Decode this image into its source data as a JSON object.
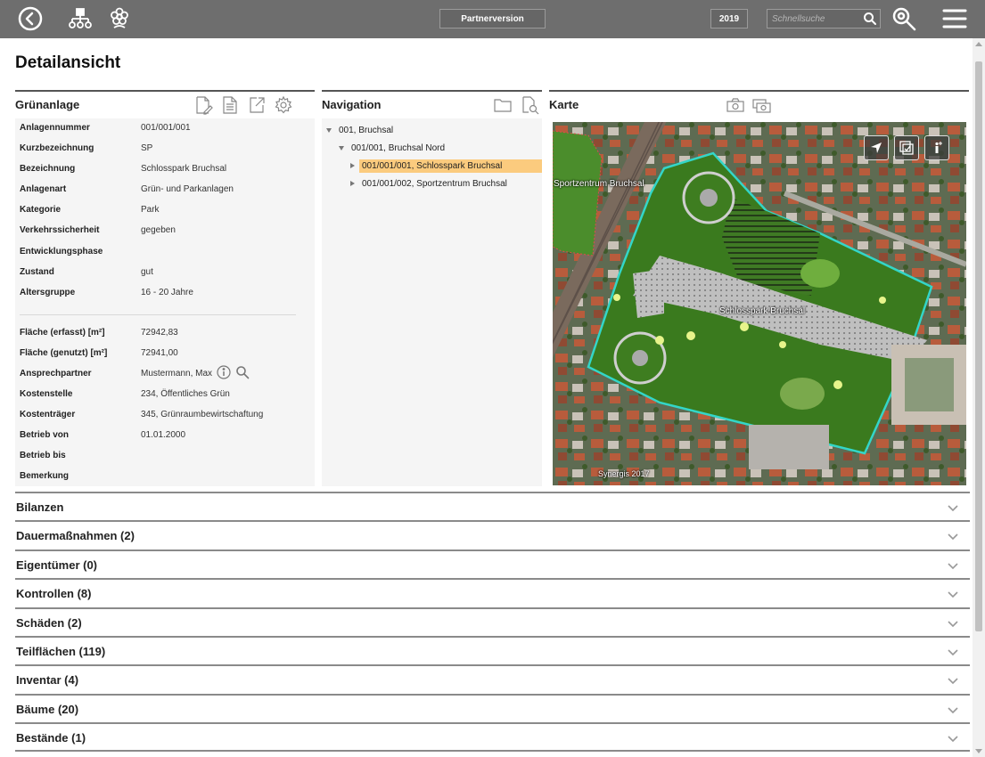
{
  "topbar": {
    "icons": [
      "back-icon",
      "hierarchy-icon",
      "flower-icon"
    ],
    "partner_label": "Partnerversion",
    "year": "2019",
    "search_placeholder": "Schnellsuche",
    "color": "#6e6e6e"
  },
  "page_title": "Detailansicht",
  "gruenanlage": {
    "title": "Grünanlage",
    "tools": [
      "edit-document-icon",
      "document-icon",
      "export-icon",
      "settings-icon"
    ],
    "fields": [
      {
        "label": "Anlagennummer",
        "value": "001/001/001"
      },
      {
        "label": "Kurzbezeichnung",
        "value": "SP"
      },
      {
        "label": "Bezeichnung",
        "value": "Schlosspark Bruchsal"
      },
      {
        "label": "Anlagenart",
        "value": "Grün- und Parkanlagen"
      },
      {
        "label": "Kategorie",
        "value": "Park"
      },
      {
        "label": "Verkehrssicherheit",
        "value": "gegeben"
      },
      {
        "label": "Entwicklungsphase",
        "value": ""
      },
      {
        "label": "Zustand",
        "value": "gut"
      },
      {
        "label": "Altersgruppe",
        "value": "16 - 20 Jahre"
      }
    ],
    "fields2": [
      {
        "label": "Fläche (erfasst) [m²]",
        "value": "72942,83"
      },
      {
        "label": "Fläche (genutzt) [m²]",
        "value": "72941,00"
      },
      {
        "label": "Ansprechpartner",
        "value": "Mustermann, Max"
      },
      {
        "label": "Kostenstelle",
        "value": "234, Öffentliches Grün"
      },
      {
        "label": "Kostenträger",
        "value": "345, Grünraumbewirtschaftung"
      },
      {
        "label": "Betrieb von",
        "value": "01.01.2000"
      },
      {
        "label": "Betrieb bis",
        "value": ""
      },
      {
        "label": "Bemerkung",
        "value": ""
      }
    ]
  },
  "navigation": {
    "title": "Navigation",
    "tools": [
      "folder-icon",
      "search-document-icon"
    ],
    "tree": [
      {
        "label": "001, Bruchsal",
        "expanded": true,
        "selected": false
      },
      {
        "label": "001/001, Bruchsal Nord",
        "expanded": true,
        "selected": false
      },
      {
        "label": "001/001/001, Schlosspark Bruchsal",
        "expanded": false,
        "selected": true
      },
      {
        "label": "001/001/002, Sportzentrum Bruchsal",
        "expanded": false,
        "selected": false
      }
    ]
  },
  "karte": {
    "title": "Karte",
    "tools": [
      "camera-icon",
      "camera-multi-icon"
    ],
    "map_buttons": [
      "locate-icon",
      "edit-area-icon",
      "info-icon"
    ],
    "labels": {
      "sport": "Sportzentrum Bruchsal",
      "park": "Schlosspark Bruchsal",
      "copyright": "Synergis 2017"
    },
    "outline_color": "#33d6c8"
  },
  "sections": [
    {
      "label": "Bilanzen"
    },
    {
      "label": "Dauermaßnahmen (2)"
    },
    {
      "label": "Eigentümer (0)"
    },
    {
      "label": "Kontrollen (8)"
    },
    {
      "label": "Schäden (2)"
    },
    {
      "label": "Teilflächen (119)"
    },
    {
      "label": "Inventar (4)"
    },
    {
      "label": "Bäume (20)"
    },
    {
      "label": "Bestände (1)"
    }
  ]
}
